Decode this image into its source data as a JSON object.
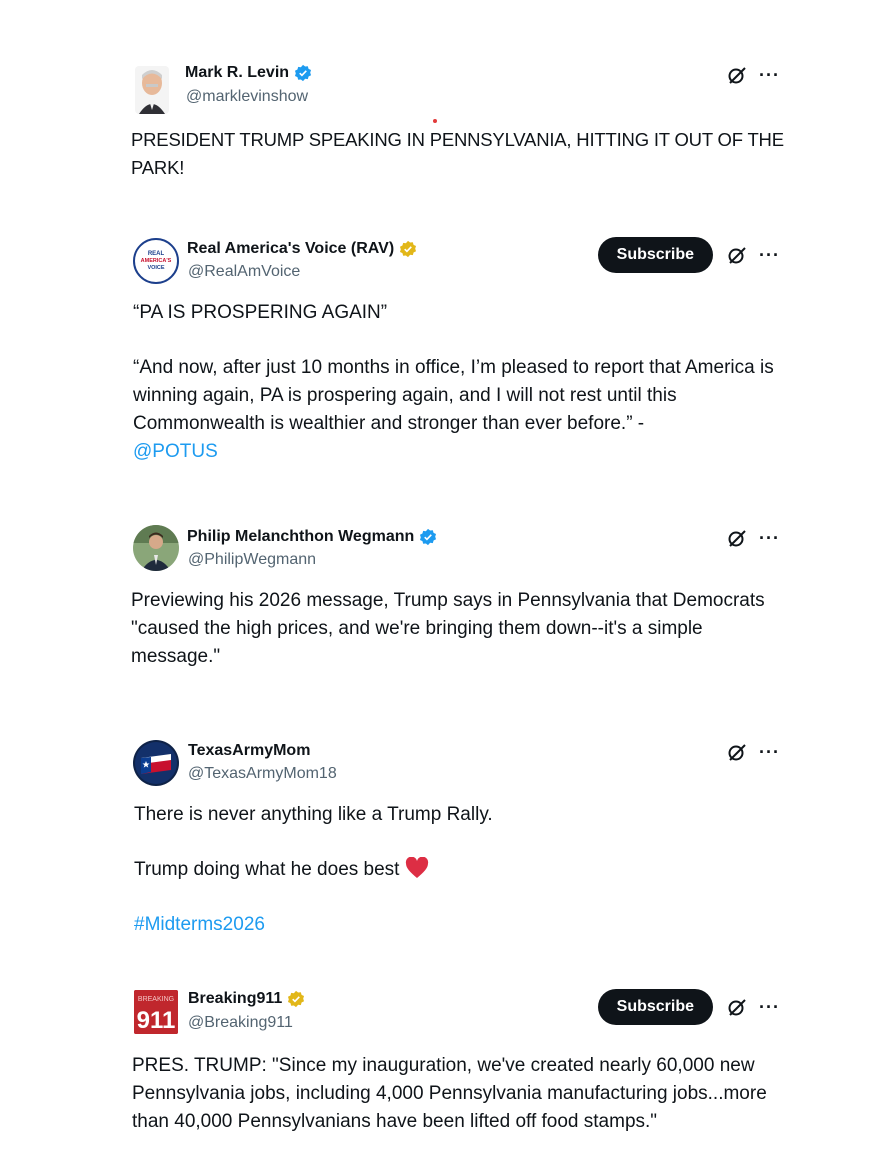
{
  "tweets": [
    {
      "name": "Mark R. Levin",
      "handle": "@marklevinshow",
      "badge": "blue",
      "subscribe": false,
      "paragraphs": [
        "PRESIDENT TRUMP SPEAKING IN PENNSYLVANIA, HITTING IT OUT OF THE PARK!"
      ]
    },
    {
      "name": "Real America's Voice (RAV)",
      "handle": "@RealAmVoice",
      "badge": "gold",
      "subscribe": true,
      "subscribe_label": "Subscribe",
      "paragraphs": [
        "“PA IS PROSPERING AGAIN”",
        "“And now, after just 10 months in office, I’m pleased to report that America is winning again, PA is prospering again, and I will not rest until this Commonwealth is wealthier and stronger than ever before.” -"
      ],
      "mention": "@POTUS"
    },
    {
      "name": "Philip Melanchthon Wegmann",
      "handle": "@PhilipWegmann",
      "badge": "blue",
      "subscribe": false,
      "paragraphs": [
        "Previewing his 2026 message, Trump says in Pennsylvania that Democrats \"caused the high prices, and we're bringing them down--it's a simple message.\""
      ]
    },
    {
      "name": "TexasArmyMom",
      "handle": "@TexasArmyMom18",
      "badge": "none",
      "subscribe": false,
      "paragraphs": [
        "There is never anything like a Trump Rally.",
        "Trump doing what he does best"
      ],
      "hashtag": "#Midterms2026"
    },
    {
      "name": "Breaking911",
      "handle": "@Breaking911",
      "badge": "gold",
      "subscribe": true,
      "subscribe_label": "Subscribe",
      "paragraphs": [
        "PRES. TRUMP: \"Since my inauguration, we've created nearly 60,000 new Pennsylvania jobs, including 4,000 Pennsylvania manufacturing jobs...more than 40,000 Pennsylvanians have been lifted off food stamps.\""
      ]
    }
  ],
  "avatar_text": {
    "rav": [
      "REAL",
      "AMERICA'S",
      "VOICE"
    ],
    "breaking_top": "BREAKING",
    "breaking_num": "911"
  },
  "colors": {
    "link": "#1d9bf0",
    "blue_badge": "#1d9bf0",
    "gold_badge": "#e2b719",
    "heart": "#e0245e"
  },
  "icons": {
    "grok": "grok-icon",
    "more": "more-icon",
    "heart": "heart-icon"
  }
}
